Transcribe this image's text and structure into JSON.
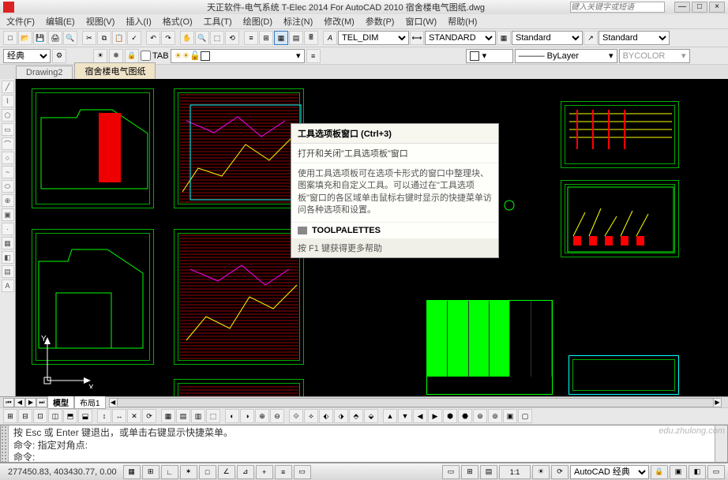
{
  "title": "天正软件-电气系统 T-Elec 2014  For AutoCAD 2010      宿舍楼电气图纸.dwg",
  "search_placeholder": "键入关键字或短语",
  "menu": [
    "文件(F)",
    "编辑(E)",
    "视图(V)",
    "插入(I)",
    "格式(O)",
    "工具(T)",
    "绘图(D)",
    "标注(N)",
    "修改(M)",
    "参数(P)",
    "窗口(W)",
    "帮助(H)"
  ],
  "styles": {
    "dim": "TEL_DIM",
    "text": "STANDARD",
    "table": "Standard",
    "mleader": "Standard"
  },
  "layer_row": {
    "left_label": "经典",
    "tab_checkbox": "TAB",
    "layer_name": "",
    "linetype": "ByLayer",
    "color": "BYCOLOR"
  },
  "doc_tabs": {
    "tab1": "Drawing2",
    "tab2": "宿舍楼电气图纸"
  },
  "tooltip": {
    "title": "工具选项板窗口 (Ctrl+3)",
    "subtitle": "打开和关闭\"工具选项板\"窗口",
    "body": "使用工具选项板可在选项卡形式的窗口中整理块、图案填充和自定义工具。可以通过在\"工具选项板\"窗口的各区域单击鼠标右键时显示的快捷菜单访问各种选项和设置。",
    "command": "TOOLPALETTES",
    "help": "按 F1 键获得更多帮助"
  },
  "layout_tabs": {
    "model": "模型",
    "layout1": "布局1"
  },
  "command": {
    "line1": "按 Esc 或 Enter 键退出，或单击右键显示快捷菜单。",
    "line2": "命令: 指定对角点:",
    "line3": "命令:"
  },
  "status": {
    "coords": "277450.83, 403430.77, 0.00",
    "scale_label": "1:1",
    "annoscale_label": "",
    "workspace": "AutoCAD 经典"
  },
  "ucs": {
    "x": "X",
    "y": "Y"
  },
  "watermark": "edu.zhulong.com"
}
